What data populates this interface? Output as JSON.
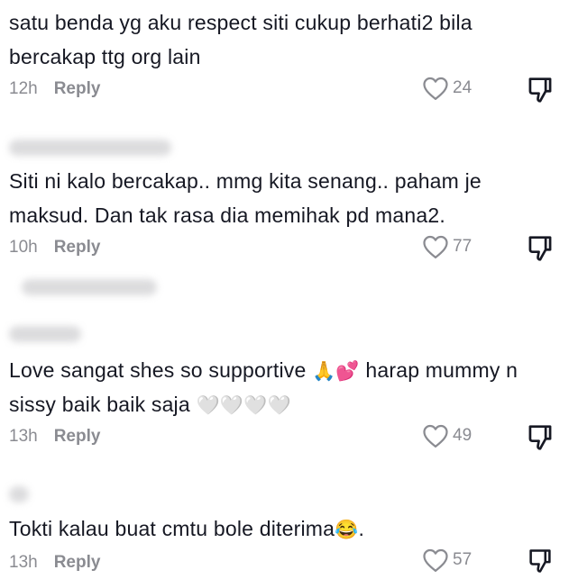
{
  "comments": [
    {
      "text": "satu benda yg aku respect siti cukup berhati2 bila bercakap ttg org lain",
      "time": "12h",
      "reply": "Reply",
      "likes": "24"
    },
    {
      "text": "Siti ni kalo bercakap.. mmg kita senang.. paham je maksud. Dan tak rasa dia memihak pd mana2.",
      "time": "10h",
      "reply": "Reply",
      "likes": "77"
    },
    {
      "text_a": "Love sangat shes so supportive ",
      "emoji_a": "🙏💕",
      "text_b": " harap mummy n sissy baik baik saja ",
      "emoji_b": "🤍🤍🤍🤍",
      "time": "13h",
      "reply": "Reply",
      "likes": "49"
    },
    {
      "text_a": "Tokti kalau buat cmtu bole diterima",
      "emoji_a": "😂",
      "text_b": ".",
      "time": "13h",
      "reply": "Reply",
      "likes": "57"
    }
  ],
  "icons": {
    "like": "heart-outline-icon",
    "dislike": "thumbs-down-icon"
  },
  "colors": {
    "text": "#161823",
    "meta": "#8a8b91",
    "blur": "#d6d6d8"
  }
}
